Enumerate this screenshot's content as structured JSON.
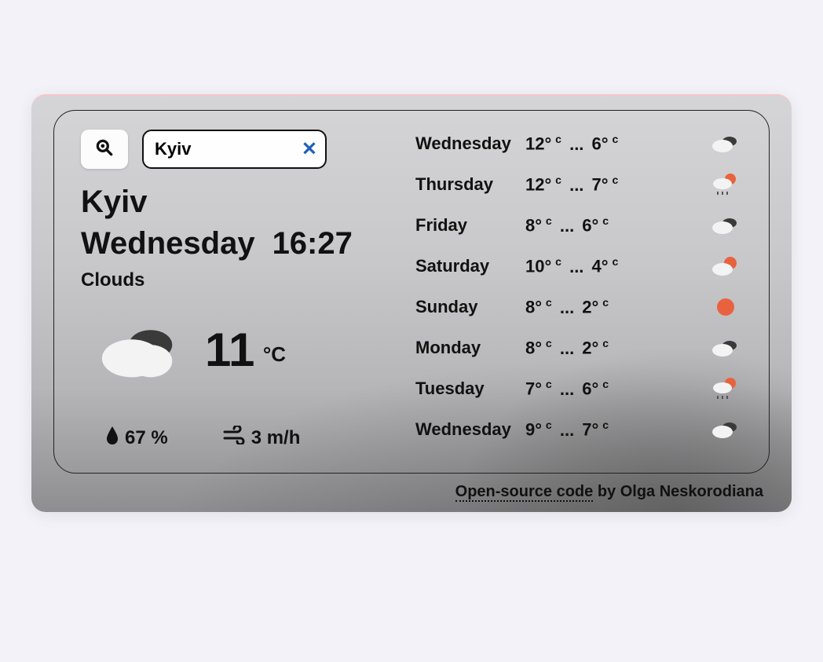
{
  "search": {
    "value": "Kyiv",
    "placeholder": ""
  },
  "current": {
    "city": "Kyiv",
    "day": "Wednesday",
    "time": "16:27",
    "condition": "Clouds",
    "temp": "11",
    "unit": "°C",
    "humidity": "67 %",
    "wind": "3 m/h",
    "icon": "cloud"
  },
  "forecast": [
    {
      "day": "Wednesday",
      "high": "12",
      "low": "6",
      "icon": "cloud"
    },
    {
      "day": "Thursday",
      "high": "12",
      "low": "7",
      "icon": "rain-sun"
    },
    {
      "day": "Friday",
      "high": "8",
      "low": "6",
      "icon": "cloud"
    },
    {
      "day": "Saturday",
      "high": "10",
      "low": "4",
      "icon": "cloud-sun"
    },
    {
      "day": "Sunday",
      "high": "8",
      "low": "2",
      "icon": "sun"
    },
    {
      "day": "Monday",
      "high": "8",
      "low": "2",
      "icon": "cloud"
    },
    {
      "day": "Tuesday",
      "high": "7",
      "low": "6",
      "icon": "rain-sun"
    },
    {
      "day": "Wednesday",
      "high": "9",
      "low": "7",
      "icon": "cloud"
    }
  ],
  "footer": {
    "link_text": "Open-source code",
    "byline": " by Olga Neskorodiana"
  },
  "labels": {
    "range_sep": " ... "
  },
  "colors": {
    "accent": "#e9623f",
    "text": "#111111",
    "clear_x": "#1e5fb8"
  }
}
